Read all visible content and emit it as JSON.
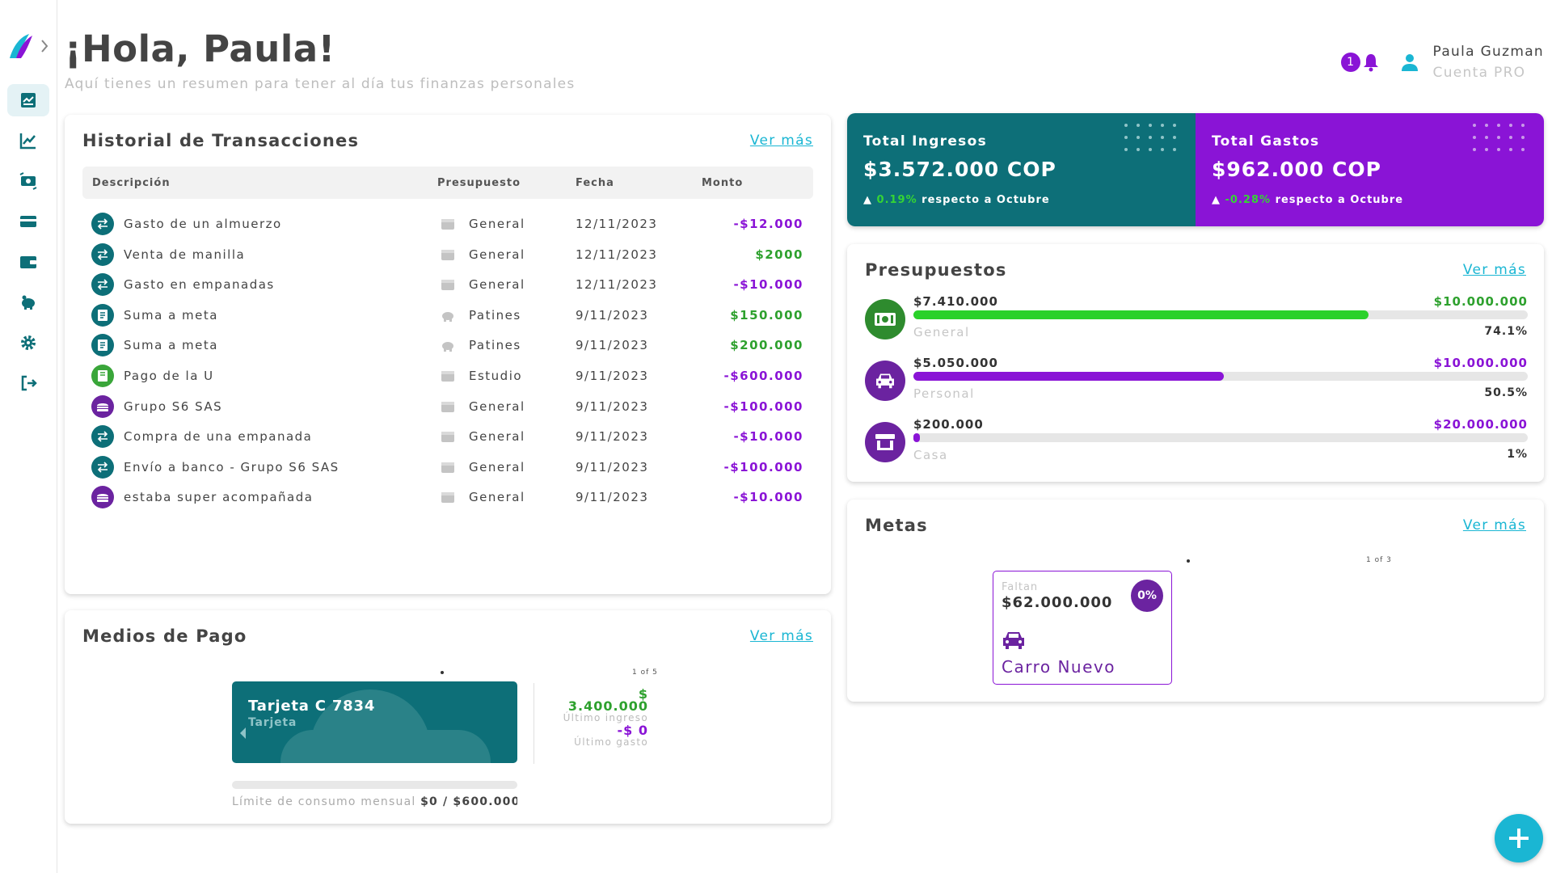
{
  "header": {
    "greeting": "¡Hola, Paula!",
    "subtitle": "Aquí tienes un resumen para tener al día tus finanzas personales",
    "notifications": "1",
    "user_name": "Paula Guzman",
    "user_plan": "Cuenta PRO"
  },
  "sidebar": {
    "items": [
      {
        "icon": "dashboard-icon",
        "active": true
      },
      {
        "icon": "chart-line-icon",
        "active": false
      },
      {
        "icon": "money-exchange-icon",
        "active": false
      },
      {
        "icon": "credit-card-icon",
        "active": false
      },
      {
        "icon": "wallet-icon",
        "active": false
      },
      {
        "icon": "piggy-bank-icon",
        "active": false
      },
      {
        "icon": "settings-icon",
        "active": false
      },
      {
        "icon": "logout-icon",
        "active": false
      }
    ]
  },
  "transactions": {
    "title": "Historial de Transacciones",
    "ver_mas": "Ver más",
    "columns": [
      "Descripción",
      "Presupuesto",
      "Fecha",
      "Monto"
    ],
    "rows": [
      {
        "desc": "Gasto de un almuerzo",
        "budget": "General",
        "date": "12/11/2023",
        "amount": "-$12.000",
        "type": "neg",
        "icon": "transfer"
      },
      {
        "desc": "Venta de manilla",
        "budget": "General",
        "date": "12/11/2023",
        "amount": "$2000",
        "type": "pos",
        "icon": "transfer"
      },
      {
        "desc": "Gasto en empanadas",
        "budget": "General",
        "date": "12/11/2023",
        "amount": "-$10.000",
        "type": "neg",
        "icon": "transfer"
      },
      {
        "desc": "Suma a meta",
        "budget": "Patines",
        "date": "9/11/2023",
        "amount": "$150.000",
        "type": "pos",
        "icon": "receipt"
      },
      {
        "desc": "Suma a meta",
        "budget": "Patines",
        "date": "9/11/2023",
        "amount": "$200.000",
        "type": "pos",
        "icon": "receipt"
      },
      {
        "desc": "Pago de la U",
        "budget": "Estudio",
        "date": "9/11/2023",
        "amount": "-$600.000",
        "type": "neg",
        "icon": "book"
      },
      {
        "desc": "Grupo S6 SAS",
        "budget": "General",
        "date": "9/11/2023",
        "amount": "-$100.000",
        "type": "neg",
        "icon": "burger"
      },
      {
        "desc": "Compra de una empanada",
        "budget": "General",
        "date": "9/11/2023",
        "amount": "-$10.000",
        "type": "neg",
        "icon": "transfer"
      },
      {
        "desc": "Envío a banco - Grupo S6 SAS",
        "budget": "General",
        "date": "9/11/2023",
        "amount": "-$100.000",
        "type": "neg",
        "icon": "transfer"
      },
      {
        "desc": "estaba super acompañada",
        "budget": "General",
        "date": "9/11/2023",
        "amount": "-$10.000",
        "type": "neg",
        "icon": "burger"
      }
    ]
  },
  "payment_methods": {
    "title": "Medios de Pago",
    "ver_mas": "Ver más",
    "pager": "1 of 5",
    "card_name": "Tarjeta C 7834",
    "card_type": "Tarjeta",
    "limit_label": "Límite de consumo mensual",
    "limit_value": "$0 / $600.000",
    "last_income_currency": "$",
    "last_income_value": "3.400.000",
    "last_income_label": "Último ingreso",
    "last_expense_value": "-$ 0",
    "last_expense_label": "Último gasto"
  },
  "totals": {
    "income_label": "Total Ingresos",
    "income_value": "$3.572.000 COP",
    "income_pct": "0.19%",
    "income_note": "respecto a Octubre",
    "expense_label": "Total Gastos",
    "expense_value": "$962.000 COP",
    "expense_pct": "-0.28%",
    "expense_note": "respecto a Octubre"
  },
  "budgets": {
    "title": "Presupuestos",
    "ver_mas": "Ver más",
    "items": [
      {
        "spent": "$7.410.000",
        "total": "$10.000.000",
        "name": "General",
        "pct": "74.1%",
        "fill": 0.741,
        "color": "#2ad12a",
        "total_color": "#2ea12e",
        "circle": "#2e8b2e",
        "icon": "money-icon"
      },
      {
        "spent": "$5.050.000",
        "total": "$10.000.000",
        "name": "Personal",
        "pct": "50.5%",
        "fill": 0.505,
        "color": "#8a14d6",
        "total_color": "#8a14d6",
        "circle": "#6b23a0",
        "icon": "car-icon"
      },
      {
        "spent": "$200.000",
        "total": "$20.000.000",
        "name": "Casa",
        "pct": "1%",
        "fill": 0.01,
        "color": "#8a14d6",
        "total_color": "#8a14d6",
        "circle": "#6b23a0",
        "icon": "store-icon"
      }
    ]
  },
  "goals": {
    "title": "Metas",
    "ver_mas": "Ver más",
    "pager": "1 of 3",
    "remaining_label": "Faltan",
    "remaining_value": "$62.000.000",
    "pct": "0%",
    "name": "Carro Nuevo"
  }
}
